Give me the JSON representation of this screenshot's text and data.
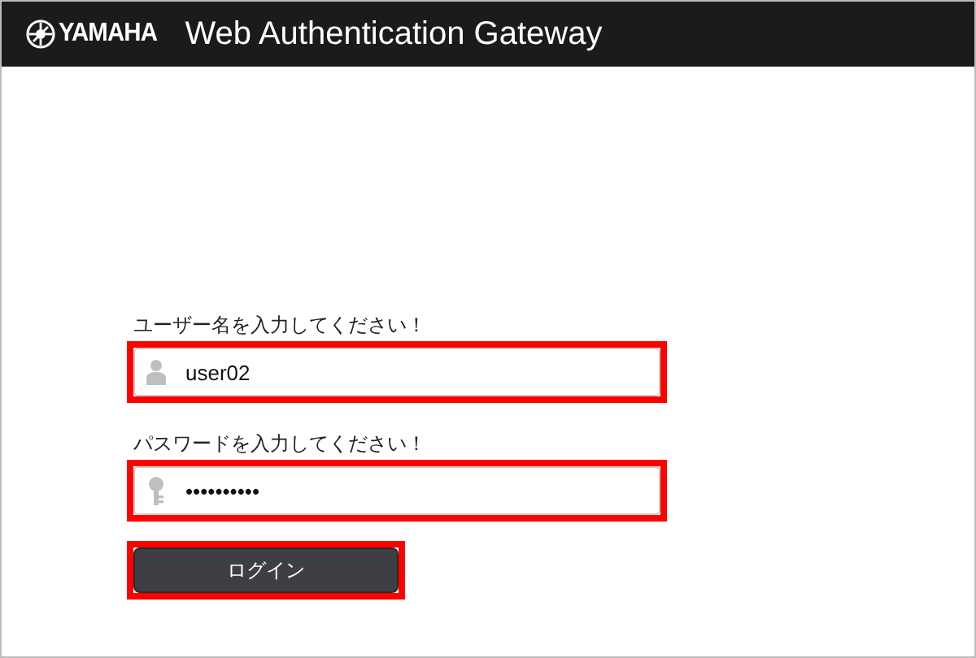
{
  "header": {
    "logo": "YAMAHA",
    "title": "Web Authentication Gateway"
  },
  "fields": [
    {
      "kind": "user",
      "label": "ユーザー名を入力してください！",
      "value": "user02",
      "highlighted": true
    },
    {
      "kind": "password",
      "label": "パスワードを入力してください！",
      "value": "••••••••••",
      "highlighted": true
    }
  ],
  "login_button": {
    "label": "ログイン",
    "highlighted": true
  }
}
